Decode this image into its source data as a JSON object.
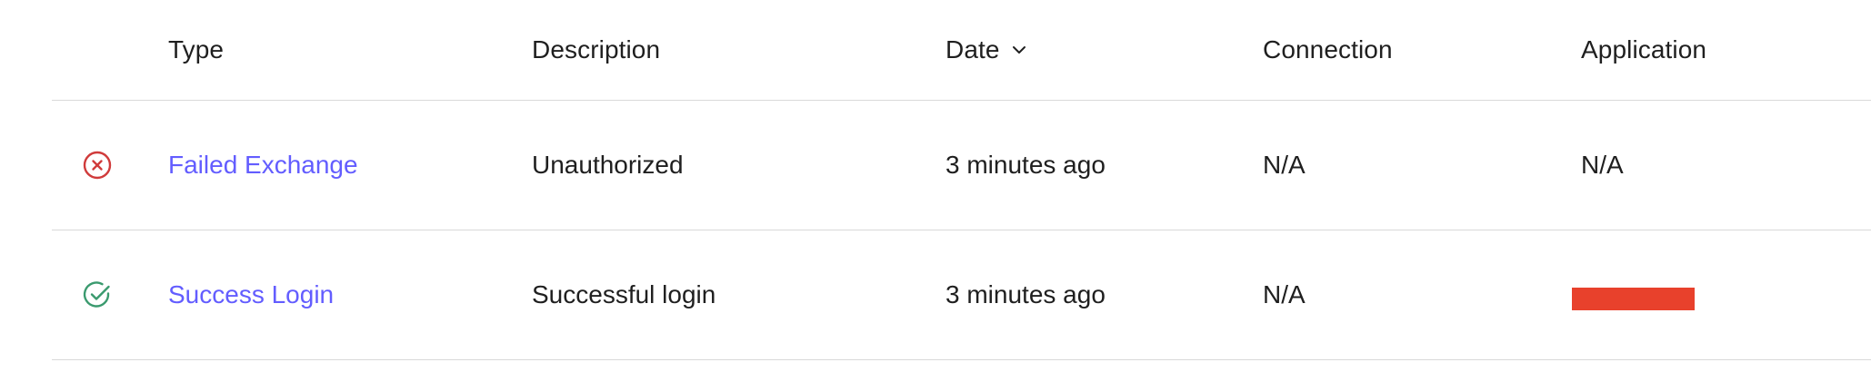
{
  "table": {
    "columns": {
      "type": "Type",
      "description": "Description",
      "date": "Date",
      "connection": "Connection",
      "application": "Application"
    },
    "sort": {
      "column": "date",
      "direction": "descending",
      "icon": "chevron-down-icon"
    },
    "rows": [
      {
        "status_icon": "x-circle-icon",
        "status_color": "#d03b3b",
        "type": "Failed Exchange",
        "description": "Unauthorized",
        "date": "3 minutes ago",
        "connection": "N/A",
        "application": "N/A"
      },
      {
        "status_icon": "check-circle-icon",
        "status_color": "#3a9a6e",
        "type": "Success Login",
        "description": "Successful login",
        "date": "3 minutes ago",
        "connection": "N/A",
        "application": "",
        "application_redacted": true
      }
    ]
  },
  "colors": {
    "link": "#635dff",
    "divider": "#d9d9d9",
    "redaction": "#e8412c"
  }
}
